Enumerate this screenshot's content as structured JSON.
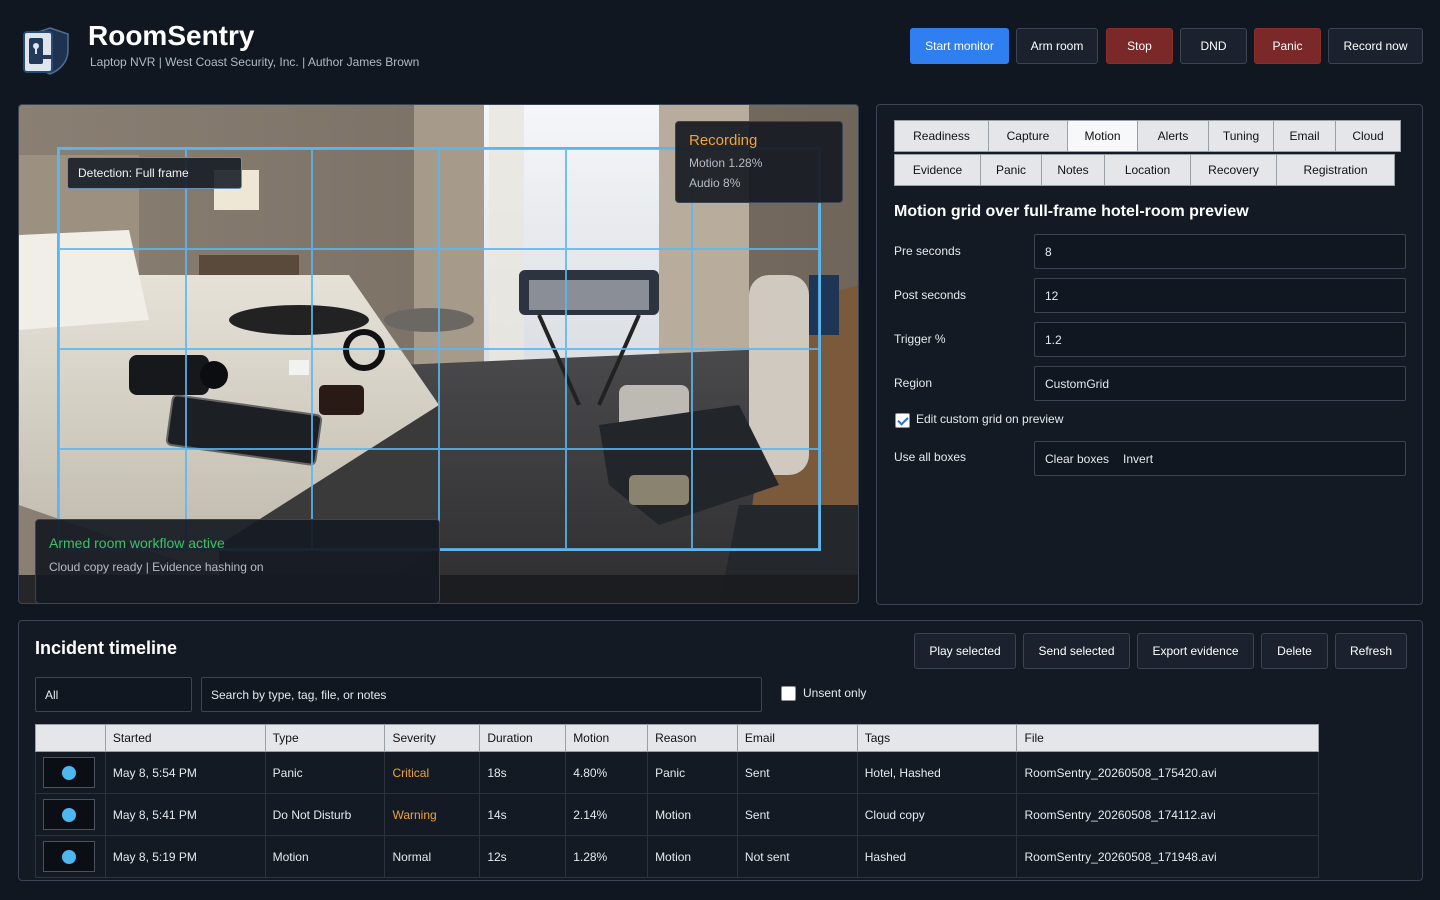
{
  "header": {
    "title": "RoomSentry",
    "subtitle": "Laptop NVR | West Coast Security, Inc. | Author James Brown",
    "logo_icon": "door-lock-icon"
  },
  "toolbar": {
    "start_monitor": "Start monitor",
    "arm_room": "Arm room",
    "stop": "Stop",
    "dnd": "DND",
    "panic": "Panic",
    "record_now": "Record now"
  },
  "preview": {
    "detection_label": "Detection: Full frame",
    "recording": {
      "title": "Recording",
      "motion": "Motion 1.28%",
      "audio": "Audio 8%"
    },
    "armed": {
      "title": "Armed room workflow active",
      "subtitle": "Cloud copy ready | Evidence hashing on"
    }
  },
  "settings": {
    "tabs_row1": [
      "Readiness",
      "Capture",
      "Motion",
      "Alerts",
      "Tuning",
      "Email",
      "Cloud"
    ],
    "tabs_row2": [
      "Evidence",
      "Panic",
      "Notes",
      "Location",
      "Recovery",
      "Registration"
    ],
    "active_tab": "Motion",
    "title": "Motion grid over full-frame hotel-room preview",
    "fields": {
      "pre_seconds": {
        "label": "Pre seconds",
        "value": "8"
      },
      "post_seconds": {
        "label": "Post seconds",
        "value": "12"
      },
      "trigger": {
        "label": "Trigger %",
        "value": "1.2"
      },
      "region": {
        "label": "Region",
        "value": "CustomGrid"
      }
    },
    "edit_grid_label": "Edit custom grid on preview",
    "edit_grid_checked": true,
    "use_all_boxes": "Use all boxes",
    "clear_boxes": "Clear boxes",
    "invert": "Invert"
  },
  "timeline": {
    "title": "Incident timeline",
    "buttons": {
      "play": "Play selected",
      "send": "Send selected",
      "export": "Export evidence",
      "delete": "Delete",
      "refresh": "Refresh"
    },
    "filter_value": "All",
    "search_placeholder": "Search by type, tag, file, or notes",
    "unsent_only": "Unsent only",
    "columns": [
      "",
      "Started",
      "Type",
      "Severity",
      "Duration",
      "Motion",
      "Reason",
      "Email",
      "Tags",
      "File"
    ],
    "rows": [
      {
        "started": "May 8, 5:54 PM",
        "type": "Panic",
        "severity": "Critical",
        "duration": "18s",
        "motion": "4.80%",
        "reason": "Panic",
        "email": "Sent",
        "tags": "Hotel, Hashed",
        "file": "RoomSentry_20260508_175420.avi"
      },
      {
        "started": "May 8, 5:41 PM",
        "type": "Do Not Disturb",
        "severity": "Warning",
        "duration": "14s",
        "motion": "2.14%",
        "reason": "Motion",
        "email": "Sent",
        "tags": "Cloud copy",
        "file": "RoomSentry_20260508_174112.avi"
      },
      {
        "started": "May 8, 5:19 PM",
        "type": "Motion",
        "severity": "Normal",
        "duration": "12s",
        "motion": "1.28%",
        "reason": "Motion",
        "email": "Not sent",
        "tags": "Hashed",
        "file": "RoomSentry_20260508_171948.avi"
      }
    ]
  },
  "colors": {
    "accent": "#2f7ff0",
    "danger": "#7b2828",
    "recording": "#f0a23b",
    "armed": "#3cc06a",
    "grid": "#5cb6ee"
  }
}
